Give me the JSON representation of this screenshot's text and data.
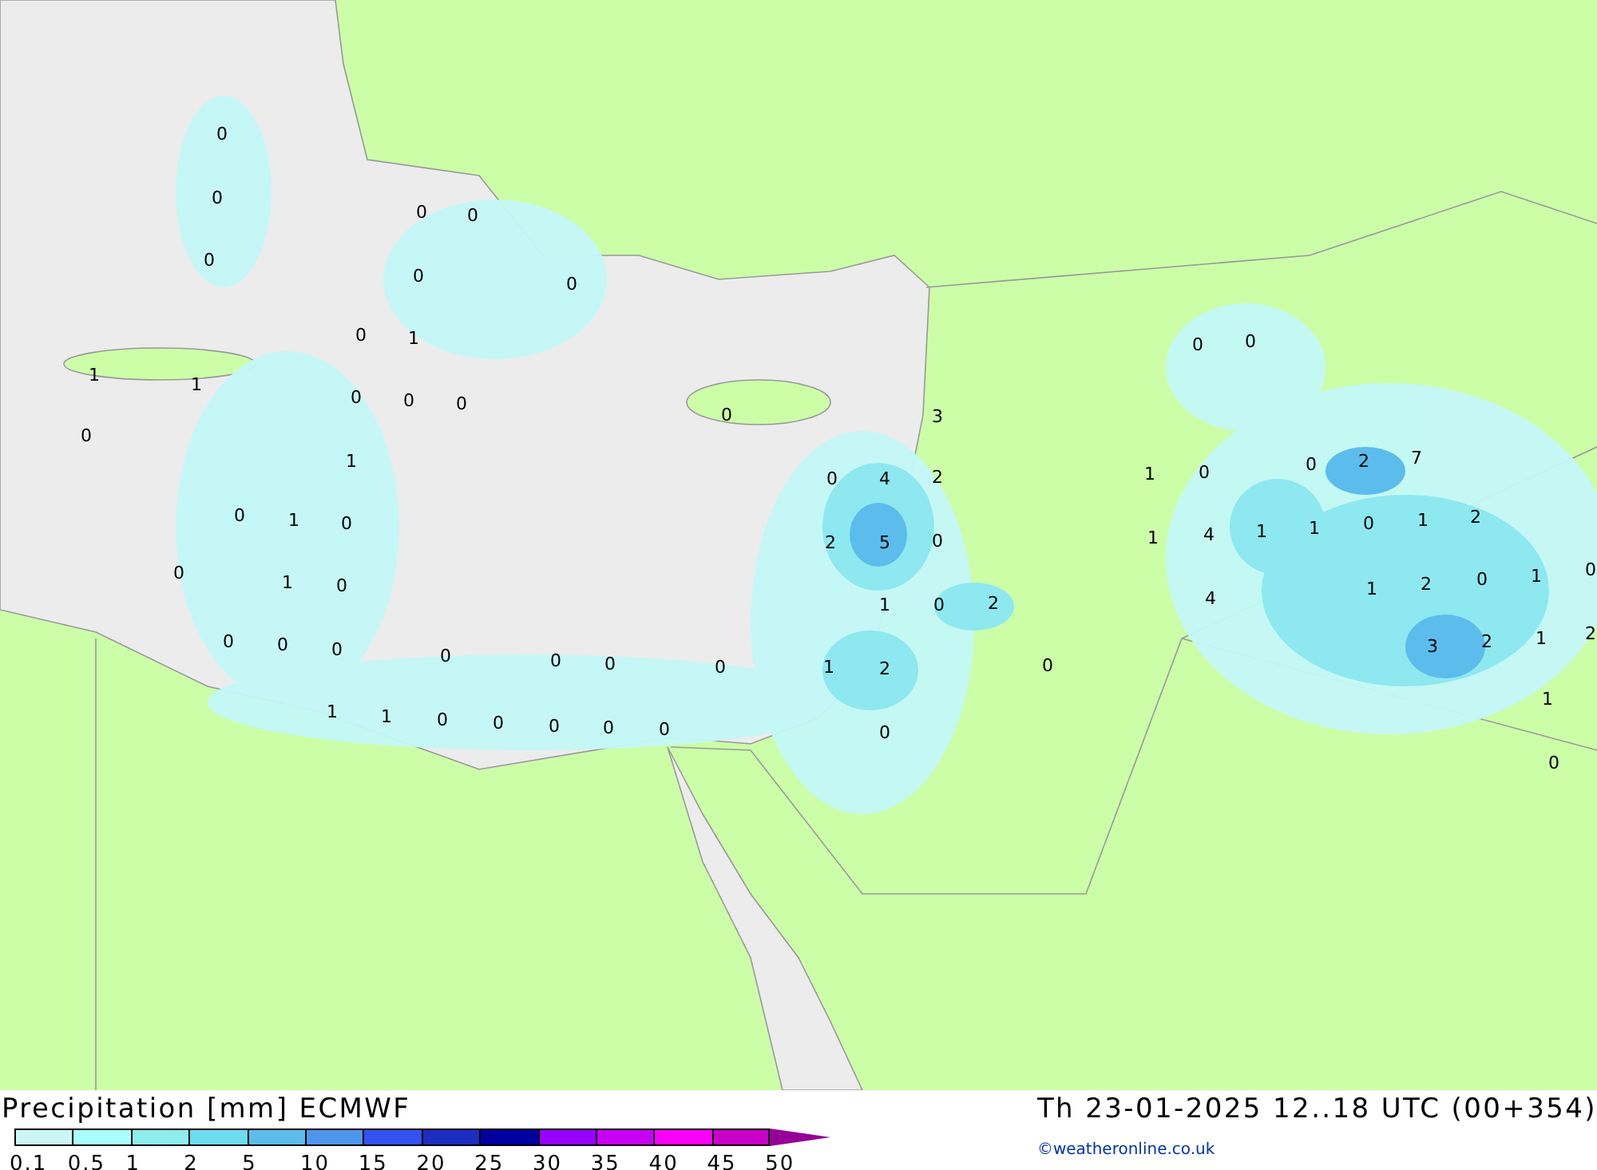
{
  "map_labels": [
    "0",
    "0",
    "0",
    "0",
    "0",
    "0",
    "0",
    "0",
    "1",
    "1",
    "1",
    "0",
    "0",
    "0",
    "0",
    "0",
    "3",
    "1",
    "0",
    "4",
    "2",
    "0",
    "1",
    "0",
    "2",
    "5",
    "0",
    "0",
    "1",
    "0",
    "1",
    "0",
    "2",
    "0",
    "0",
    "0",
    "0",
    "0",
    "0",
    "0",
    "1",
    "2",
    "0",
    "1",
    "1",
    "0",
    "0",
    "0",
    "0",
    "0",
    "0",
    "0",
    "0",
    "1",
    "0",
    "0",
    "2",
    "7",
    "1",
    "4",
    "1",
    "1",
    "0",
    "1",
    "2",
    "4",
    "1",
    "2",
    "0",
    "1",
    "0",
    "3",
    "2",
    "1",
    "2",
    "1",
    "0"
  ],
  "title": "Precipitation [mm] ECMWF",
  "valid_time": "Th 23-01-2025 12..18 UTC (00+354)",
  "legend": {
    "segments": [
      {
        "color": "#ccf6f6"
      },
      {
        "color": "#a8fefe"
      },
      {
        "color": "#8eeeee"
      },
      {
        "color": "#6cdcee"
      },
      {
        "color": "#5cbcec"
      },
      {
        "color": "#4e96ec"
      },
      {
        "color": "#3452f0"
      },
      {
        "color": "#1c2ec0"
      },
      {
        "color": "#0000a0"
      },
      {
        "color": "#9600fc"
      },
      {
        "color": "#c800f4"
      },
      {
        "color": "#fa00fa"
      },
      {
        "color": "#c800c8"
      },
      {
        "kind": "arrow",
        "color": "#960096"
      }
    ],
    "labels": [
      "0.1",
      "0.5",
      "1",
      "2",
      "5",
      "10",
      "15",
      "20",
      "25",
      "30",
      "35",
      "40",
      "45",
      "50"
    ]
  },
  "credit": "©weatheronline.co.uk"
}
